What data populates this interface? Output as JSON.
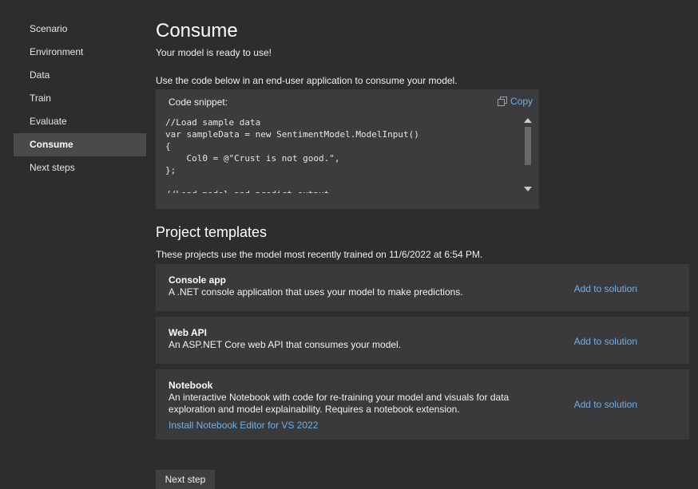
{
  "sidebar": {
    "items": [
      {
        "label": "Scenario",
        "active": false
      },
      {
        "label": "Environment",
        "active": false
      },
      {
        "label": "Data",
        "active": false
      },
      {
        "label": "Train",
        "active": false
      },
      {
        "label": "Evaluate",
        "active": false
      },
      {
        "label": "Consume",
        "active": true
      },
      {
        "label": "Next steps",
        "active": false
      }
    ]
  },
  "main": {
    "title": "Consume",
    "subtitle": "Your model is ready to use!",
    "instructions": "Use the code below in an end-user application to consume your model."
  },
  "snippet": {
    "label": "Code snippet:",
    "copy_label": "Copy",
    "code": "//Load sample data\nvar sampleData = new SentimentModel.ModelInput()\n{\n    Col0 = @\"Crust is not good.\",\n};\n\n//Load model and predict output"
  },
  "templates": {
    "title": "Project templates",
    "description": "These projects use the model most recently trained on 11/6/2022 at 6:54 PM.",
    "cards": [
      {
        "title": "Console app",
        "description": "A .NET console application that uses your model to make predictions.",
        "action": "Add to solution"
      },
      {
        "title": "Web API",
        "description": "An ASP.NET Core web API that consumes your model.",
        "action": "Add to solution"
      },
      {
        "title": "Notebook",
        "description": "An interactive Notebook with code for re-training your model and visuals for data exploration and model explainability. Requires a notebook extension.",
        "action": "Add to solution",
        "link": "Install Notebook Editor for VS 2022"
      }
    ]
  },
  "footer": {
    "next_label": "Next step"
  },
  "colors": {
    "background": "#2d2d30",
    "active_nav": "#4a4a4c",
    "card_background": "#3a3a3c",
    "link": "#6fb0e6"
  }
}
